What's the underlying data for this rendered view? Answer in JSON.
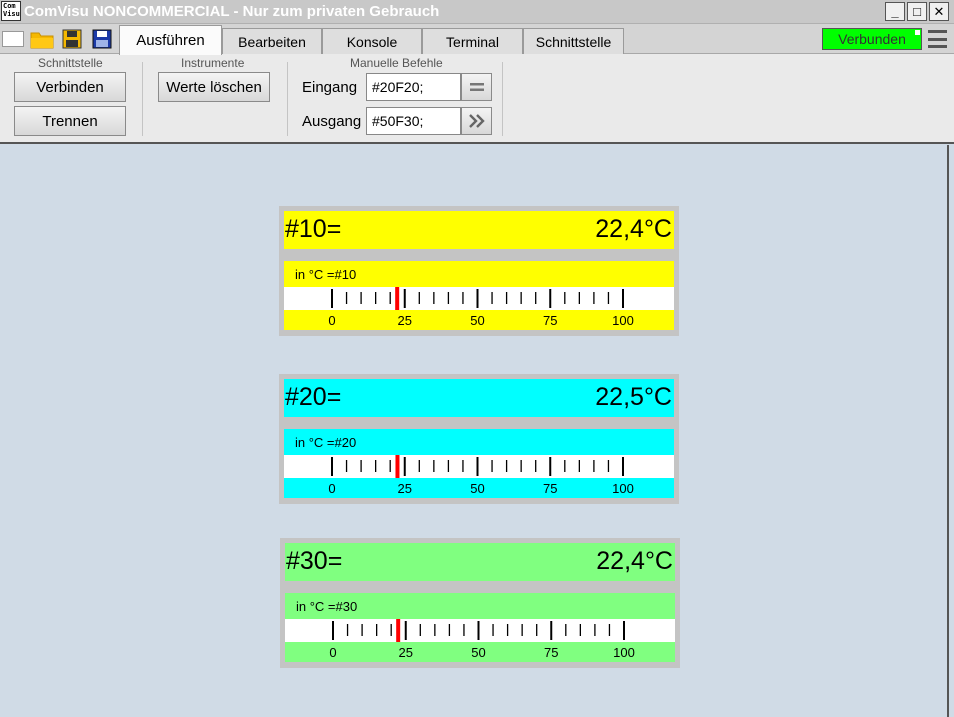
{
  "window": {
    "title": "ComVisu NONCOMMERCIAL - Nur zum privaten Gebrauch",
    "app_icon_text": "Com Visu",
    "minimize": "_",
    "maximize": "□",
    "close": "✕"
  },
  "toolbar_icons": [
    "new-file-icon",
    "open-folder-icon",
    "save-icon",
    "save-as-icon"
  ],
  "tabs": [
    {
      "label": "Ausführen",
      "active": true
    },
    {
      "label": "Bearbeiten",
      "active": false
    },
    {
      "label": "Konsole",
      "active": false
    },
    {
      "label": "Terminal",
      "active": false
    },
    {
      "label": "Schnittstelle",
      "active": false
    }
  ],
  "status": {
    "label": "Verbunden",
    "color": "#00ff00"
  },
  "ribbon": {
    "interface": {
      "group_label": "Schnittstelle",
      "connect": "Verbinden",
      "disconnect": "Trennen"
    },
    "instruments": {
      "group_label": "Instrumente",
      "clear": "Werte löschen"
    },
    "manual": {
      "group_label": "Manuelle Befehle",
      "input_label": "Eingang",
      "input_value": "#20F20;",
      "output_label": "Ausgang",
      "output_value": "#50F30;",
      "input_button_icon": "equals-icon",
      "output_button_icon": "double-chevron-right-icon"
    }
  },
  "instruments": [
    {
      "name": "#10=",
      "value": "22,4°C",
      "scale_label": "in °C =#10",
      "color": "#ffff00",
      "reading": 22.4,
      "ticks": [
        "0",
        "25",
        "50",
        "75",
        "100"
      ],
      "scale_min": 0,
      "scale_max": 100
    },
    {
      "name": "#20=",
      "value": "22,5°C",
      "scale_label": "in °C =#20",
      "color": "#00ffff",
      "reading": 22.5,
      "ticks": [
        "0",
        "25",
        "50",
        "75",
        "100"
      ],
      "scale_min": 0,
      "scale_max": 100
    },
    {
      "name": "#30=",
      "value": "22,4°C",
      "scale_label": "in °C =#30",
      "color": "#80ff80",
      "reading": 22.4,
      "ticks": [
        "0",
        "25",
        "50",
        "75",
        "100"
      ],
      "scale_min": 0,
      "scale_max": 100
    }
  ]
}
